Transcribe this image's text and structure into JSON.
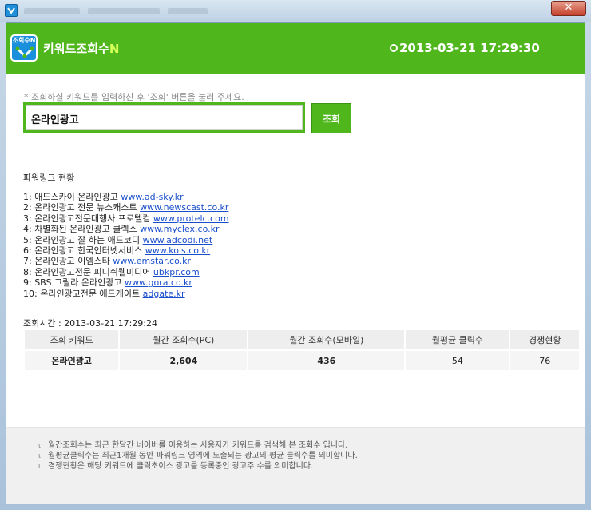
{
  "app": {
    "title": "키워드조회수",
    "title_suffix": "N",
    "logo_label": "조회수N",
    "datetime": "2013-03-21 17:29:30"
  },
  "window": {
    "close_label": "✕"
  },
  "search": {
    "hint": "* 조회하실 키워드를 입력하신 후 '조회' 버튼을 눌러 주세요.",
    "value": "온라인광고",
    "button_label": "조회"
  },
  "powerlinks": {
    "title": "파워링크 현황",
    "items": [
      {
        "prefix": "1: 애드스카이 온라인광고",
        "url": "www.ad-sky.kr"
      },
      {
        "prefix": "2: 온라인광고 전문 뉴스캐스트",
        "url": "www.newscast.co.kr"
      },
      {
        "prefix": "3: 온라인광고전문대행사 프로텔컴",
        "url": "www.protelc.com"
      },
      {
        "prefix": "4: 차별화된 온라인광고 클렉스",
        "url": "www.myclex.co.kr"
      },
      {
        "prefix": "5: 온라인광고 잘 하는 애드코디",
        "url": "www.adcodi.net"
      },
      {
        "prefix": "6: 온라인광고 한국인터넷서비스",
        "url": "www.kois.co.kr"
      },
      {
        "prefix": "7: 온라인광고 이엠스타",
        "url": "www.emstar.co.kr"
      },
      {
        "prefix": "8: 온라인광고전문 피니쉬웰미디어",
        "url": "ubkpr.com"
      },
      {
        "prefix": "9: SBS 고릴라 온라인광고",
        "url": "www.gora.co.kr"
      },
      {
        "prefix": "10: 온라인광고전문 애드게이트",
        "url": "adgate.kr"
      }
    ]
  },
  "results": {
    "query_time": "조회시간 : 2013-03-21 17:29:24",
    "headers": [
      "조회 키워드",
      "월간 조회수(PC)",
      "월간 조회수(모바일)",
      "월평균 클릭수",
      "경쟁현황"
    ],
    "row": [
      "온라인광고",
      "2,604",
      "436",
      "54",
      "76"
    ]
  },
  "notes": [
    "월간조회수는 최근 한달간 네이버를 이용하는 사용자가 키워드를 검색해 본 조회수 입니다.",
    "월평균클릭수는 최근1개월 동안 파워링크 영역에 노출되는 광고의 평균 클릭수를 의미합니다.",
    "경쟁현황은 해당 키워드에 클릭초이스 광고를 등록중인 광고주 수를 의미합니다."
  ],
  "icons": {
    "app": "app-logo-icon",
    "clock": "clock-icon",
    "close": "close-icon",
    "note_bullet": "ι"
  },
  "colors": {
    "accent": "#4fb71c",
    "link": "#1a4fcc",
    "logo": "#1a8fdc"
  }
}
